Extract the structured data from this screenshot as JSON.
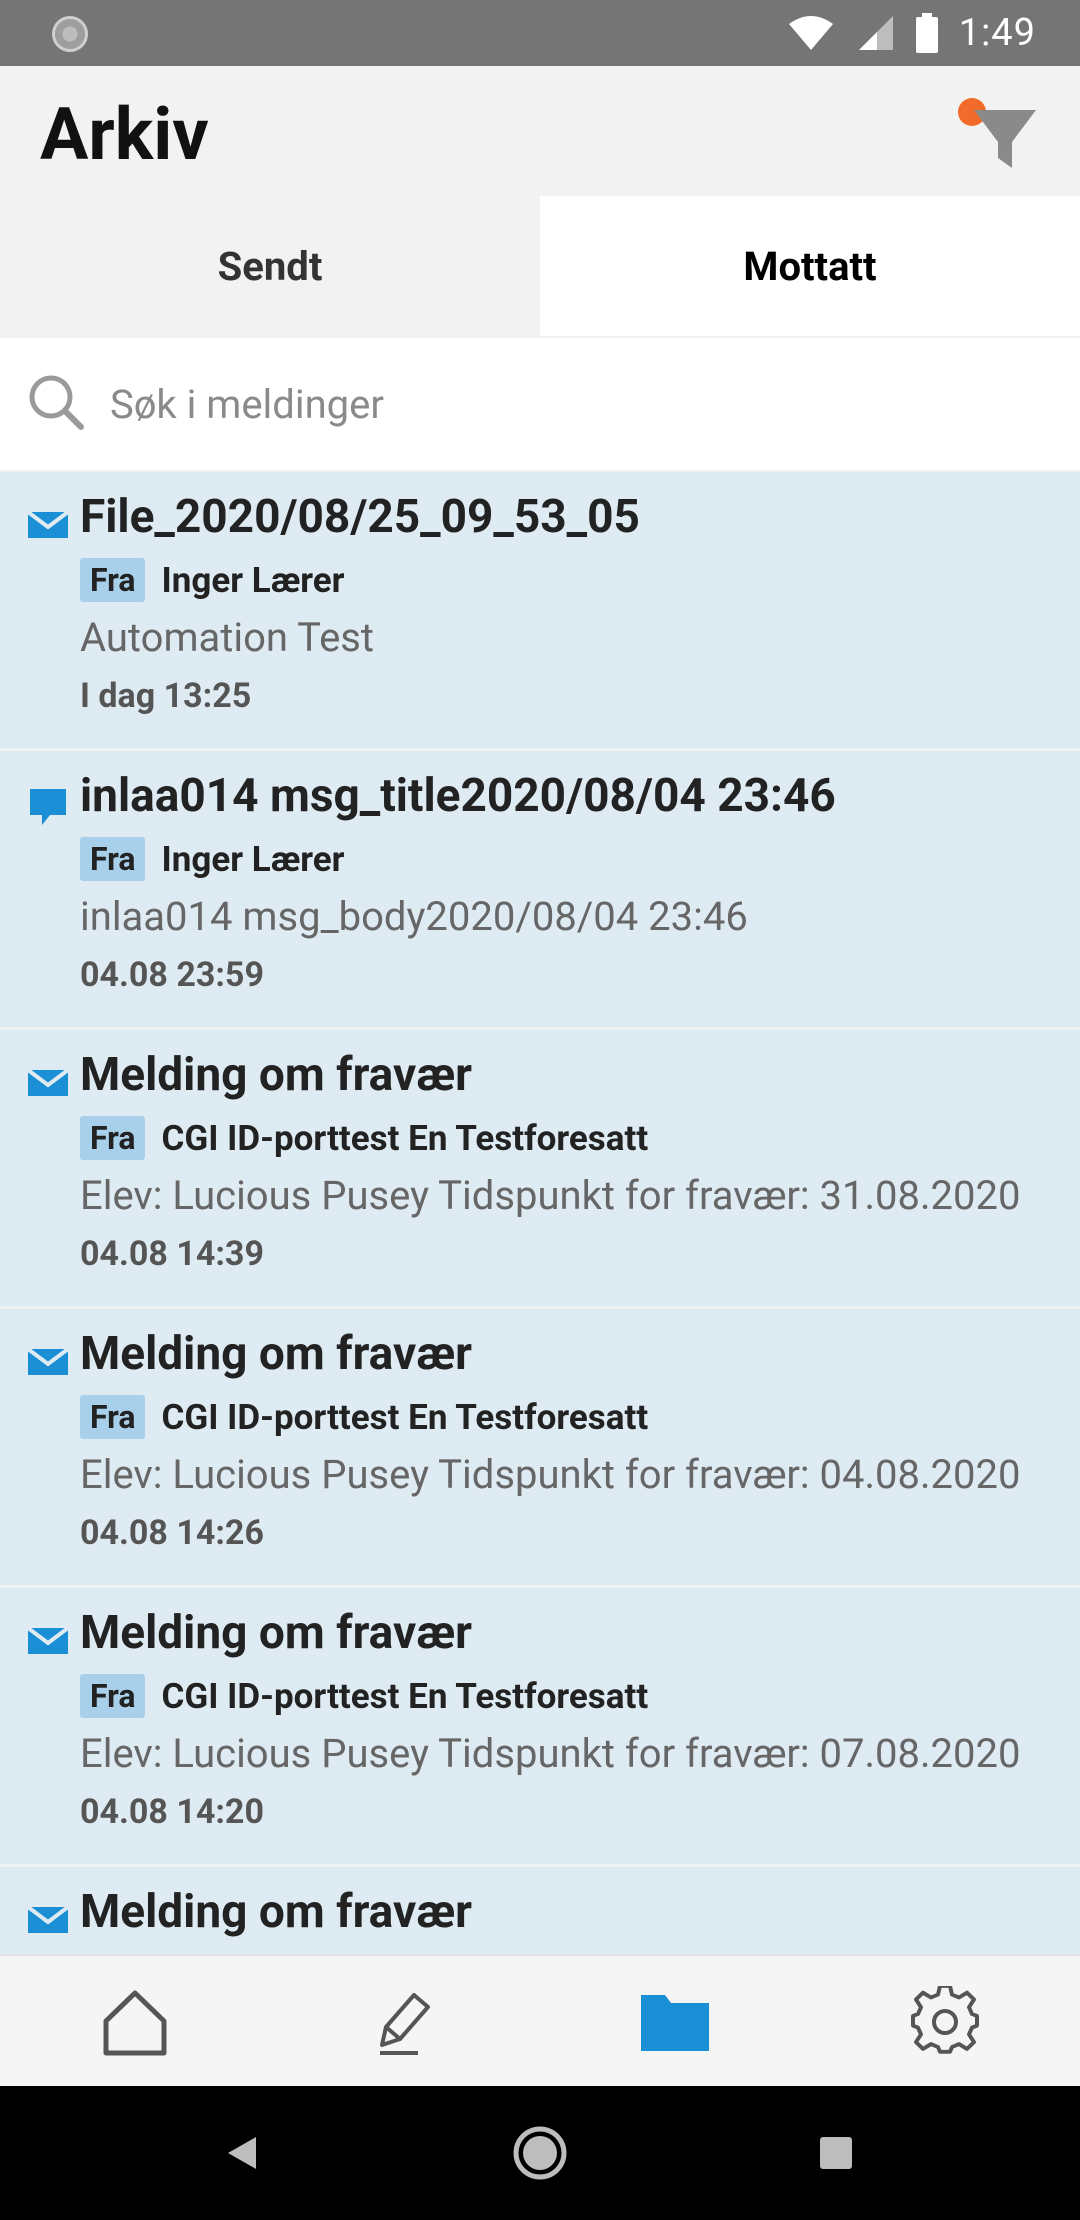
{
  "status_bar": {
    "time": "1:49",
    "icons": [
      "notification-icon",
      "wifi-icon",
      "signal-icon",
      "battery-icon"
    ]
  },
  "header": {
    "title": "Arkiv",
    "filter_icon": "filter-icon",
    "filter_indicator_color": "#f26b2b"
  },
  "tabs": [
    {
      "label": "Sendt",
      "active": false
    },
    {
      "label": "Mottatt",
      "active": true
    }
  ],
  "search": {
    "placeholder": "Søk i meldinger",
    "value": ""
  },
  "messages": [
    {
      "icon": "envelope-icon",
      "subject": "File_2020/08/25_09_53_05",
      "from_label": "Fra",
      "sender": "Inger Lærer",
      "preview": "Automation Test",
      "date": "I dag 13:25"
    },
    {
      "icon": "chat-bubble-icon",
      "subject": "inlaa014 msg_title2020/08/04 23:46",
      "from_label": "Fra",
      "sender": "Inger Lærer",
      "preview": "inlaa014 msg_body2020/08/04 23:46",
      "date": "04.08 23:59"
    },
    {
      "icon": "envelope-icon",
      "subject": "Melding om fravær",
      "from_label": "Fra",
      "sender": "CGI ID-porttest En Testforesatt",
      "preview": "Elev: Lucious Pusey Tidspunkt for fravær: 31.08.2020",
      "date": "04.08 14:39"
    },
    {
      "icon": "envelope-icon",
      "subject": "Melding om fravær",
      "from_label": "Fra",
      "sender": "CGI ID-porttest En Testforesatt",
      "preview": "Elev: Lucious Pusey Tidspunkt for fravær: 04.08.2020",
      "date": "04.08 14:26"
    },
    {
      "icon": "envelope-icon",
      "subject": "Melding om fravær",
      "from_label": "Fra",
      "sender": "CGI ID-porttest En Testforesatt",
      "preview": "Elev: Lucious Pusey Tidspunkt for fravær: 07.08.2020",
      "date": "04.08 14:20"
    },
    {
      "icon": "envelope-icon",
      "subject": "Melding om fravær",
      "from_label": "",
      "sender": "",
      "preview": "",
      "date": ""
    }
  ],
  "bottom_nav": [
    {
      "icon": "home-icon",
      "active": false
    },
    {
      "icon": "compose-icon",
      "active": false
    },
    {
      "icon": "folder-icon",
      "active": true
    },
    {
      "icon": "settings-icon",
      "active": false
    }
  ],
  "colors": {
    "accent": "#1a8fd6",
    "list_background": "#deebf3",
    "badge_background": "#a8d0eb"
  },
  "system_nav": [
    "back-icon",
    "home-circle-icon",
    "recents-icon"
  ]
}
